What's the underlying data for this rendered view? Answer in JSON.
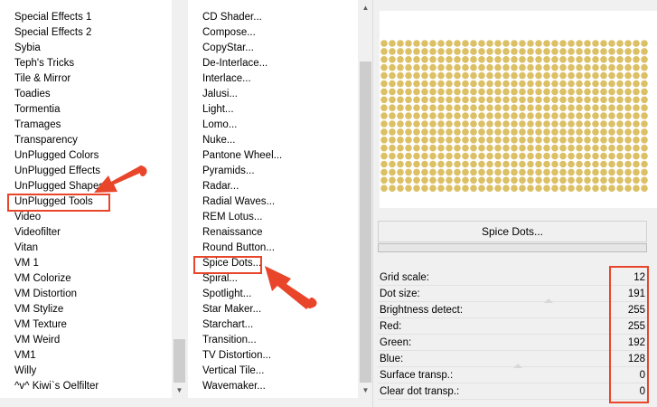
{
  "left_list": {
    "items": [
      "Special Effects 1",
      "Special Effects 2",
      "Sybia",
      "Teph's Tricks",
      "Tile & Mirror",
      "Toadies",
      "Tormentia",
      "Tramages",
      "Transparency",
      "UnPlugged Colors",
      "UnPlugged Effects",
      "UnPlugged Shapes",
      "UnPlugged Tools",
      "Video",
      "Videofilter",
      "Vitan",
      "VM 1",
      "VM Colorize",
      "VM Distortion",
      "VM Stylize",
      "VM Texture",
      "VM Weird",
      "VM1",
      "Willy",
      "^v^ Kiwi`s Oelfilter"
    ],
    "selected": "UnPlugged Tools"
  },
  "mid_list": {
    "items": [
      "CD Shader...",
      "Compose...",
      "CopyStar...",
      "De-Interlace...",
      "Interlace...",
      "Jalusi...",
      "Light...",
      "Lomo...",
      "Nuke...",
      "Pantone Wheel...",
      "Pyramids...",
      "Radar...",
      "Radial Waves...",
      "REM Lotus...",
      "Renaissance",
      "Round Button...",
      "Spice Dots...",
      "Spiral...",
      "Spotlight...",
      "Star Maker...",
      "Starchart...",
      "Transition...",
      "TV Distortion...",
      "Vertical Tile...",
      "Wavemaker..."
    ],
    "selected": "Spice Dots..."
  },
  "preview": {
    "button_label": "Spice Dots...",
    "dot_color": "#dcc066",
    "dots_shown": true
  },
  "params": [
    {
      "label": "Grid scale:",
      "value": "12"
    },
    {
      "label": "Dot size:",
      "value": "191"
    },
    {
      "label": "Brightness detect:",
      "value": "255"
    },
    {
      "label": "Red:",
      "value": "255"
    },
    {
      "label": "Green:",
      "value": "192"
    },
    {
      "label": "Blue:",
      "value": "128"
    },
    {
      "label": "Surface transp.:",
      "value": "0"
    },
    {
      "label": "Clear dot transp.:",
      "value": "0"
    }
  ],
  "colors": {
    "highlight": "#e8452a",
    "panel_bg": "#f0f0f0"
  },
  "icons": [
    "arrow-up-icon",
    "arrow-down-icon",
    "pointer-arrow-icon"
  ]
}
